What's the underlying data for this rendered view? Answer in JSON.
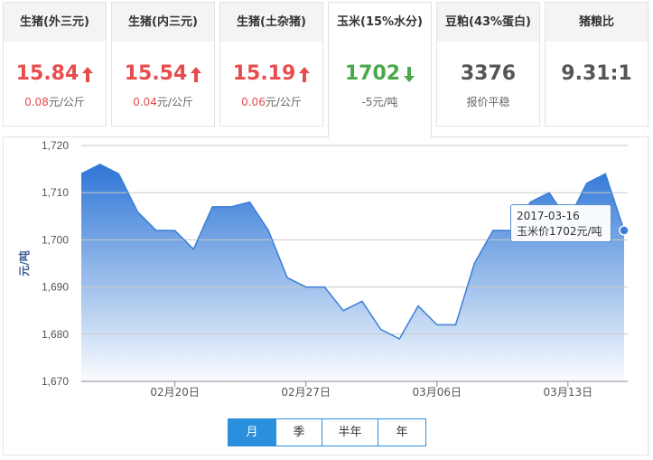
{
  "cards": [
    {
      "title": "生猪(外三元)",
      "price": "15.84",
      "trend": "up",
      "change": "0.08",
      "unit": "元/公斤"
    },
    {
      "title": "生猪(内三元)",
      "price": "15.54",
      "trend": "up",
      "change": "0.04",
      "unit": "元/公斤"
    },
    {
      "title": "生猪(土杂猪)",
      "price": "15.19",
      "trend": "up",
      "change": "0.06",
      "unit": "元/公斤"
    },
    {
      "title": "玉米(15%水分)",
      "price": "1702",
      "trend": "down",
      "change": "-5",
      "unit": "元/吨"
    },
    {
      "title": "豆粕(43%蛋白)",
      "price": "3376",
      "trend": "flat",
      "status": "报价平稳"
    },
    {
      "title": "猪粮比",
      "price": "9.31:1",
      "trend": "none"
    }
  ],
  "active_card": 3,
  "colors": {
    "up": "#e84c4c",
    "down": "#4aa84a",
    "accent": "#2a8fdc",
    "line": "#3a7fd5"
  },
  "range_tabs": [
    "月",
    "季",
    "半年",
    "年"
  ],
  "active_range": 0,
  "tooltip": {
    "date": "2017-03-16",
    "text": "玉米价1702元/吨"
  },
  "chart_data": {
    "type": "area",
    "ylabel": "元/吨",
    "ylim": [
      1670,
      1720
    ],
    "yticks": [
      1670,
      1680,
      1690,
      1700,
      1710,
      1720
    ],
    "ytick_labels": [
      "1,670",
      "1,680",
      "1,690",
      "1,700",
      "1,710",
      "1,720"
    ],
    "x": [
      "2017-02-15",
      "2017-02-16",
      "2017-02-17",
      "2017-02-18",
      "2017-02-19",
      "2017-02-20",
      "2017-02-21",
      "2017-02-22",
      "2017-02-23",
      "2017-02-24",
      "2017-02-25",
      "2017-02-26",
      "2017-02-27",
      "2017-02-28",
      "2017-03-01",
      "2017-03-02",
      "2017-03-03",
      "2017-03-04",
      "2017-03-05",
      "2017-03-06",
      "2017-03-07",
      "2017-03-08",
      "2017-03-09",
      "2017-03-10",
      "2017-03-11",
      "2017-03-12",
      "2017-03-13",
      "2017-03-14",
      "2017-03-15",
      "2017-03-16"
    ],
    "values": [
      1714,
      1716,
      1714,
      1706,
      1702,
      1702,
      1698,
      1707,
      1707,
      1708,
      1702,
      1692,
      1690,
      1690,
      1685,
      1687,
      1681,
      1679,
      1686,
      1682,
      1682,
      1695,
      1702,
      1702,
      1708,
      1710,
      1704,
      1712,
      1714,
      1702
    ],
    "xtick_labels": [
      {
        "x": "2017-02-20",
        "label": "02月20日"
      },
      {
        "x": "2017-02-27",
        "label": "02月27日"
      },
      {
        "x": "2017-03-06",
        "label": "03月06日"
      },
      {
        "x": "2017-03-13",
        "label": "03月13日"
      }
    ],
    "grid": true,
    "highlight": "2017-03-16"
  }
}
